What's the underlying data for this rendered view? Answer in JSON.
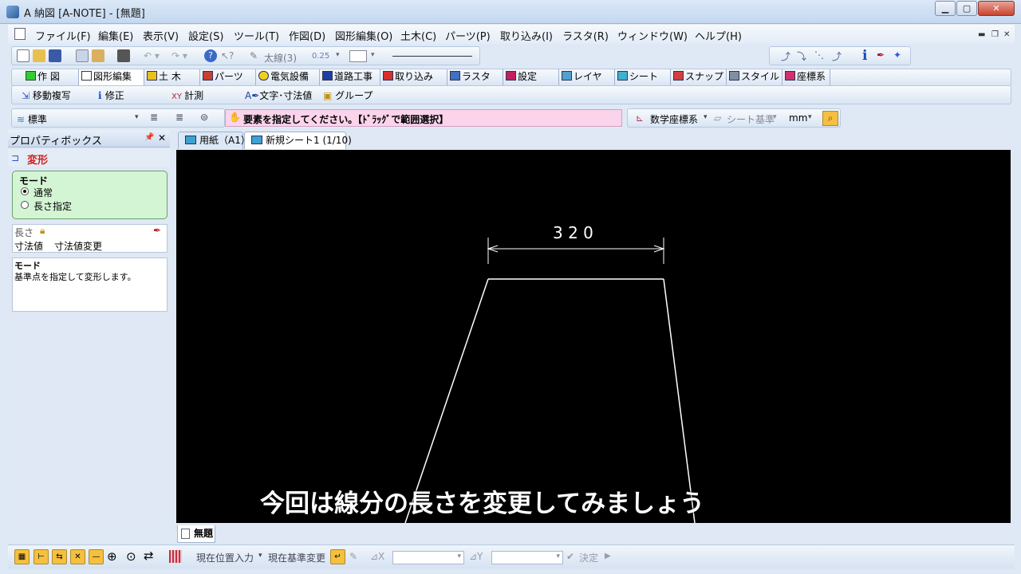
{
  "window": {
    "title": "A 納図 [A-NOTE] - [無題]"
  },
  "menu": [
    "ファイル(F)",
    "編集(E)",
    "表示(V)",
    "設定(S)",
    "ツール(T)",
    "作図(D)",
    "図形編集(O)",
    "土木(C)",
    "パーツ(P)",
    "取り込み(I)",
    "ラスタ(R)",
    "ウィンドウ(W)",
    "ヘルプ(H)"
  ],
  "toolbar1": {
    "line_type": "太線(3)",
    "line_width": "0.25"
  },
  "category_tabs": [
    "作 図",
    "図形編集",
    "土 木",
    "パーツ",
    "電気設備",
    "道路工事",
    "取り込み",
    "ラスタ",
    "設定",
    "レイヤ",
    "シート",
    "スナップ",
    "スタイル",
    "座標系"
  ],
  "sub_tools": [
    "移動複写",
    "修正",
    "計測",
    "文字･寸法値",
    "グループ"
  ],
  "layer_combo": "標準",
  "status_message": "要素を指定してください。【ﾄﾞﾗｯｸﾞで範囲選択】",
  "coord_system": "数学座標系",
  "sheet_base": "シート基準",
  "unit": "mm",
  "property_box": {
    "title": "プロパティボックス",
    "command": "変形",
    "mode_label": "モード",
    "options": [
      "通常",
      "長さ指定"
    ],
    "selected_option": "通常",
    "length_label": "長さ",
    "dimension_value": "寸法値",
    "dimension_change": "寸法値変更",
    "help_title": "モード",
    "help_text": "基準点を指定して変形します。"
  },
  "doc_tabs": [
    "用紙（A1）",
    "新規シート1 (1/10)"
  ],
  "drawing": {
    "dimension_text": "3 2 0",
    "subtitle": "今回は線分の長さを変更してみましょう"
  },
  "window_tab": "無題",
  "bottom_bar": {
    "input_mode": "現在位置入力",
    "base_change": "現在基準変更",
    "dx": "⊿X",
    "dy": "⊿Y",
    "confirm": "決定"
  }
}
